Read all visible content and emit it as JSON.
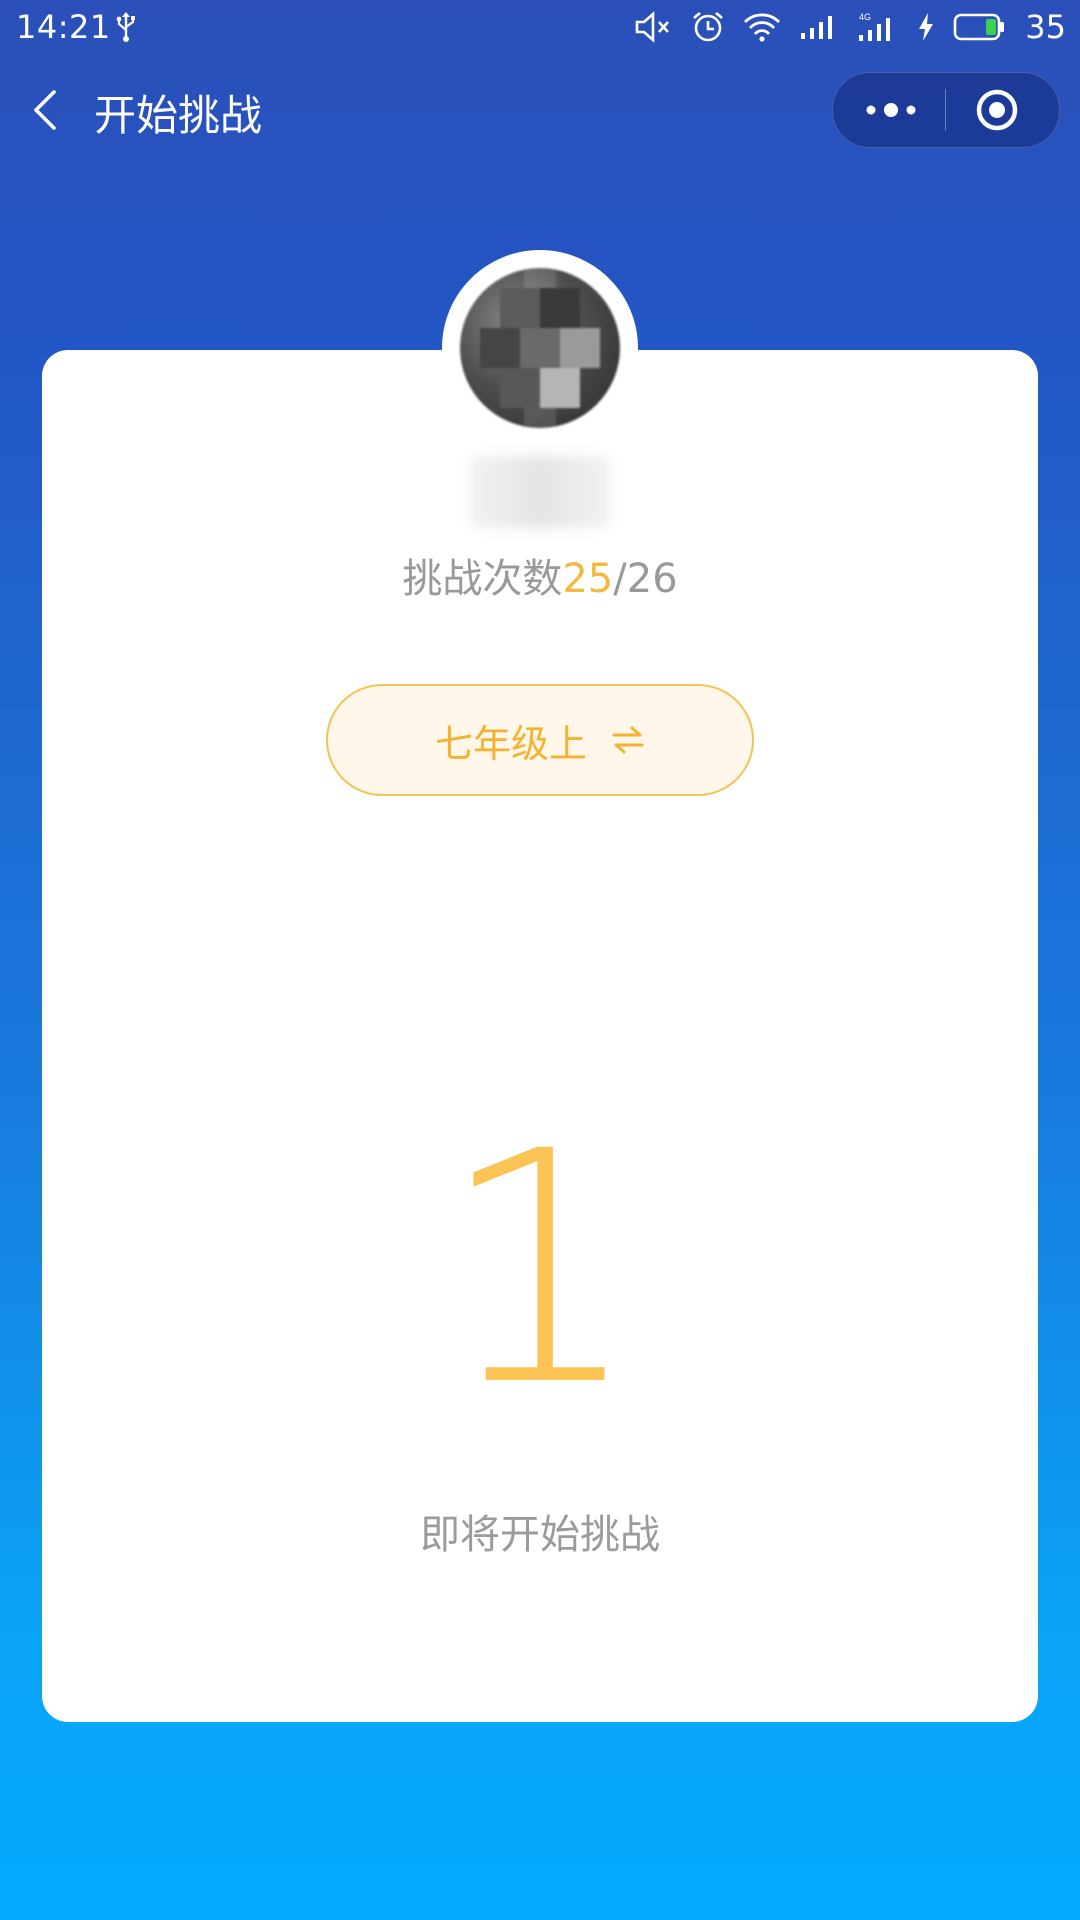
{
  "status_bar": {
    "time": "14:21",
    "battery_percent": "35",
    "network": "4G",
    "icons": [
      "usb-icon",
      "mute-icon",
      "alarm-icon",
      "wifi-icon",
      "signal-icon",
      "signal-4g-icon",
      "charging-icon",
      "battery-icon"
    ]
  },
  "nav": {
    "title": "开始挑战",
    "back_icon": "chevron-left-icon",
    "more_icon": "more-dots-icon",
    "close_icon": "target-close-icon"
  },
  "card": {
    "challenge_label": "挑战次数",
    "challenge_used": "25",
    "challenge_total": "/26",
    "grade_label": "七年级上",
    "grade_icon": "swap-arrows-icon",
    "countdown_value": "1",
    "hint": "即将开始挑战"
  },
  "colors": {
    "accent": "#fcc454",
    "gradient_top": "#2b4fb8",
    "gradient_bottom": "#04aaff"
  }
}
